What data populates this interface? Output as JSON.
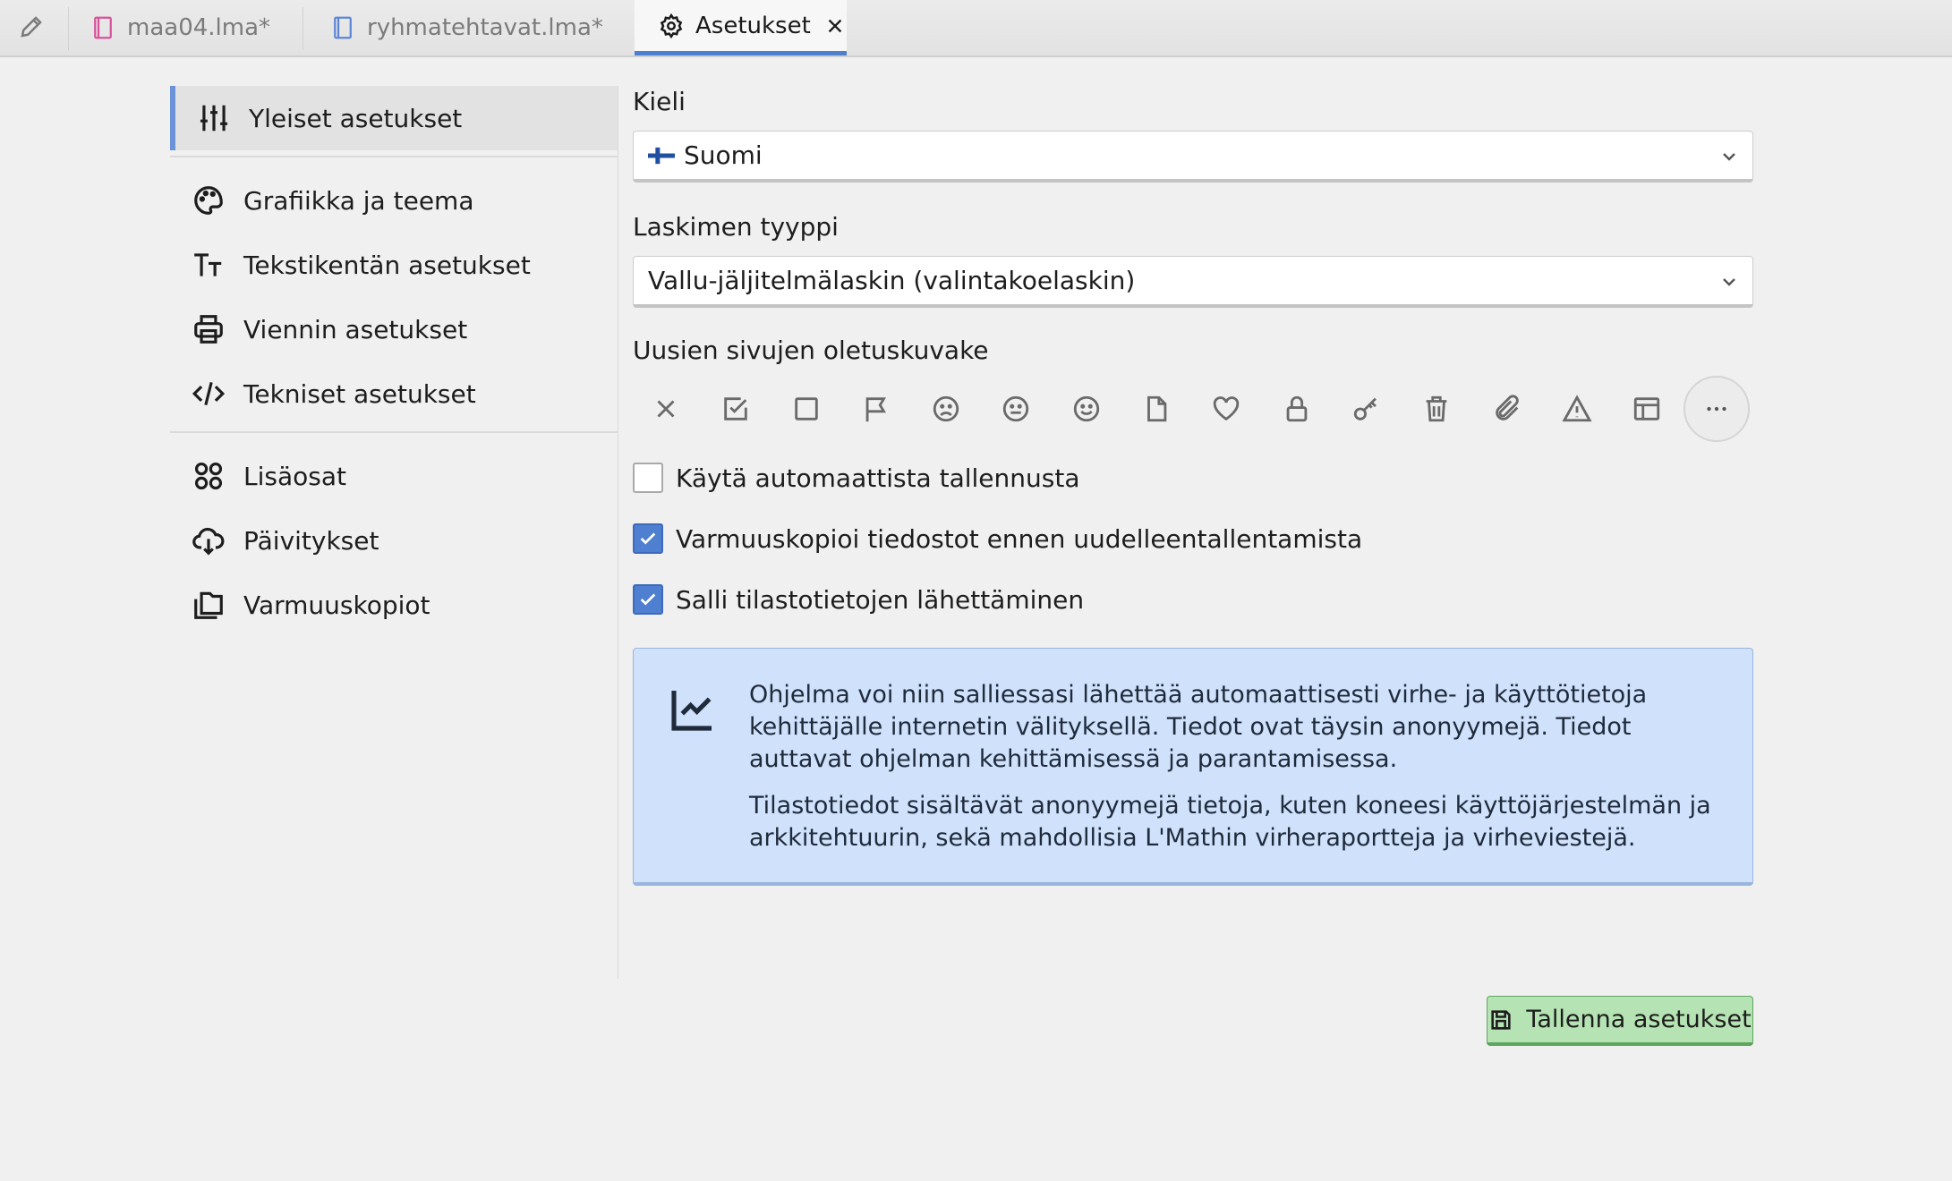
{
  "tabs": [
    {
      "label": "maa04.lma*",
      "icon": "notebook-icon",
      "color": "#d9529a"
    },
    {
      "label": "ryhmatehtavat.lma*",
      "icon": "notebook-icon",
      "color": "#5d87d6"
    },
    {
      "label": "Asetukset",
      "icon": "gear-icon",
      "active": true
    }
  ],
  "sidebar": {
    "items": [
      {
        "label": "Yleiset asetukset",
        "icon": "sliders-icon",
        "active": true
      },
      {
        "label": "Grafiikka ja teema",
        "icon": "palette-icon"
      },
      {
        "label": "Tekstikentän asetukset",
        "icon": "text-size-icon"
      },
      {
        "label": "Viennin asetukset",
        "icon": "printer-icon"
      },
      {
        "label": "Tekniset asetukset",
        "icon": "code-icon"
      },
      {
        "label": "Lisäosat",
        "icon": "apps-icon"
      },
      {
        "label": "Päivitykset",
        "icon": "cloud-download-icon"
      },
      {
        "label": "Varmuuskopiot",
        "icon": "backups-icon"
      }
    ]
  },
  "main": {
    "language": {
      "label": "Kieli",
      "value": "Suomi",
      "flag": "finland-flag-icon"
    },
    "calculator": {
      "label": "Laskimen tyyppi",
      "value": "Vallu-jäljitelmälaskin (valintakoelaskin)"
    },
    "default_icon": {
      "label": "Uusien sivujen oletuskuvake",
      "icons": [
        "x-icon",
        "checkbox-icon",
        "square-icon",
        "flag-icon",
        "frown-icon",
        "neutral-face-icon",
        "smile-icon",
        "document-icon",
        "heart-icon",
        "lock-icon",
        "key-icon",
        "trash-icon",
        "paperclip-icon",
        "warning-icon",
        "table-icon",
        "more-icon"
      ]
    },
    "checkboxes": [
      {
        "label": "Käytä automaattista tallennusta",
        "checked": false
      },
      {
        "label": "Varmuuskopioi tiedostot ennen uudelleentallentamista",
        "checked": true
      },
      {
        "label": "Salli tilastotietojen lähettäminen",
        "checked": true
      }
    ],
    "info": {
      "icon": "chart-line-icon",
      "paragraph1": "Ohjelma voi niin salliessasi lähettää automaattisesti virhe- ja käyttötietoja kehittäjälle internetin välityksellä. Tiedot ovat täysin anonyymejä. Tiedot auttavat ohjelman kehittämisessä ja parantamisessa.",
      "paragraph2": "Tilastotiedot sisältävät anonyymejä tietoja, kuten koneesi käyttöjärjestelmän ja arkkitehtuurin, sekä mahdollisia L'Mathin virheraportteja ja virheviestejä."
    },
    "save_label": "Tallenna asetukset"
  },
  "colors": {
    "accent": "#4f7fd0",
    "info_bg": "#cfe1fb",
    "save_bg": "#b5e3b3"
  }
}
